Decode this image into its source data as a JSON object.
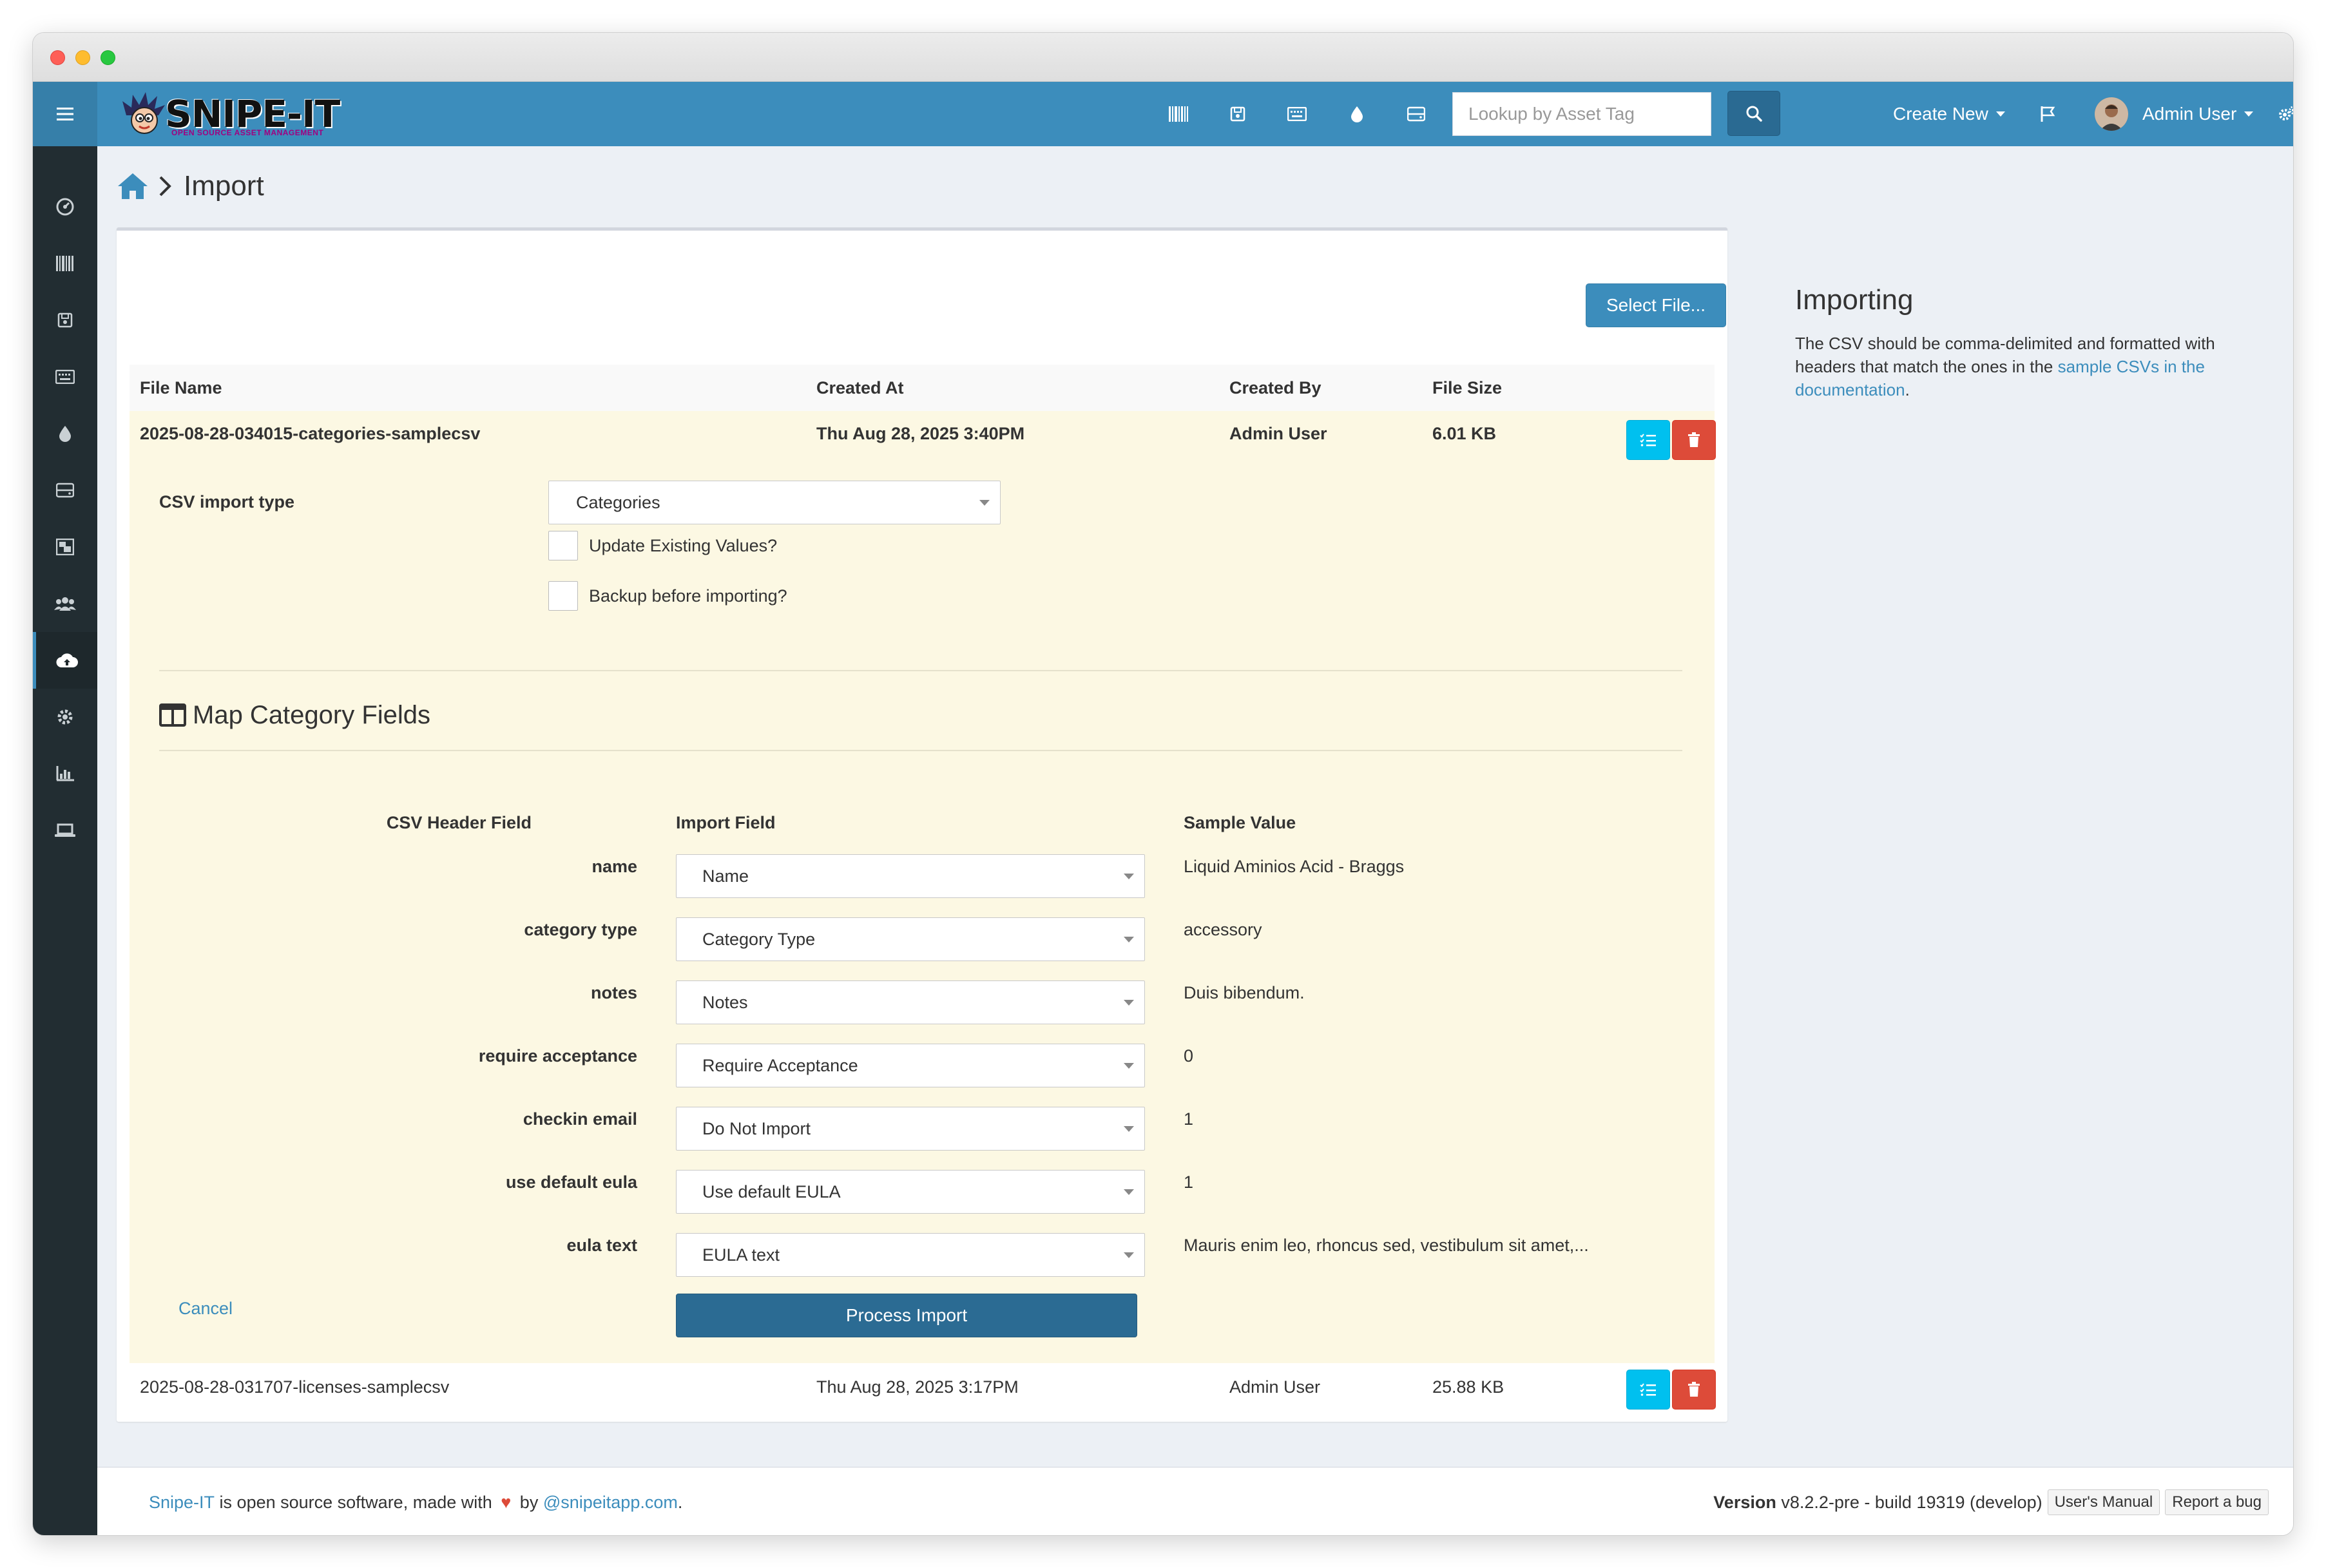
{
  "navbar": {
    "logo_text": "SNIPE-IT",
    "logo_subtitle": "OPEN SOURCE ASSET MANAGEMENT",
    "search_placeholder": "Lookup by Asset Tag",
    "create_new_label": "Create New",
    "user_name": "Admin User",
    "icons": [
      "barcode-icon",
      "save-icon",
      "keyboard-icon",
      "tint-icon",
      "hdd-icon"
    ]
  },
  "sidebar": {
    "icons": [
      "dashboard-icon",
      "barcode-icon",
      "save-icon",
      "keyboard-icon",
      "tint-icon",
      "hdd-icon",
      "puzzle-icon",
      "users-icon",
      "cloud-upload-icon",
      "cog-icon",
      "bar-chart-icon",
      "laptop-icon"
    ],
    "active": "cloud-upload-icon"
  },
  "breadcrumb": {
    "title": "Import"
  },
  "panel": {
    "select_file_label": "Select File...",
    "columns": [
      "File Name",
      "Created At",
      "Created By",
      "File Size"
    ],
    "files": [
      {
        "name": "2025-08-28-034015-categories-samplecsv",
        "created_at": "Thu Aug 28, 2025 3:40PM",
        "created_by": "Admin User",
        "size": "6.01 KB"
      },
      {
        "name": "2025-08-28-031707-licenses-samplecsv",
        "created_at": "Thu Aug 28, 2025 3:17PM",
        "created_by": "Admin User",
        "size": "25.88 KB"
      }
    ]
  },
  "import_form": {
    "csv_import_type_label": "CSV import type",
    "csv_import_type_value": "Categories",
    "update_existing_label": "Update Existing Values?",
    "backup_label": "Backup before importing?",
    "map_title": "Map Category Fields",
    "header_csv": "CSV Header Field",
    "header_import": "Import Field",
    "header_sample": "Sample Value",
    "mappings": [
      {
        "csv": "name",
        "field": "Name",
        "sample": "Liquid Aminios Acid - Braggs"
      },
      {
        "csv": "category type",
        "field": "Category Type",
        "sample": "accessory"
      },
      {
        "csv": "notes",
        "field": "Notes",
        "sample": "Duis bibendum."
      },
      {
        "csv": "require acceptance",
        "field": "Require Acceptance",
        "sample": "0"
      },
      {
        "csv": "checkin email",
        "field": "Do Not Import",
        "sample": "1"
      },
      {
        "csv": "use default eula",
        "field": "Use default EULA",
        "sample": "1"
      },
      {
        "csv": "eula text",
        "field": "EULA text",
        "sample": "Mauris enim leo, rhoncus sed, vestibulum sit amet,..."
      }
    ],
    "cancel_label": "Cancel",
    "process_label": "Process Import"
  },
  "aside": {
    "title": "Importing",
    "text_before": "The CSV should be comma-delimited and formatted with headers that match the ones in the ",
    "link_text": "sample CSVs in the documentation",
    "text_after": "."
  },
  "footer": {
    "brand": "Snipe-IT",
    "text_mid": " is open source software, made with ",
    "text_by": " by ",
    "author_link": "@snipeitapp.com",
    "period": ".",
    "version_label": "Version",
    "version_value": " v8.2.2-pre - build 19319 (develop)",
    "manual_label": "User's Manual",
    "bug_label": "Report a bug"
  },
  "colors": {
    "navbar": "#3c8dbc",
    "sidebar": "#222d32",
    "active_row": "#fcf8e3",
    "info": "#00c0ef",
    "danger": "#dd4b39",
    "process": "#2b6b93"
  }
}
